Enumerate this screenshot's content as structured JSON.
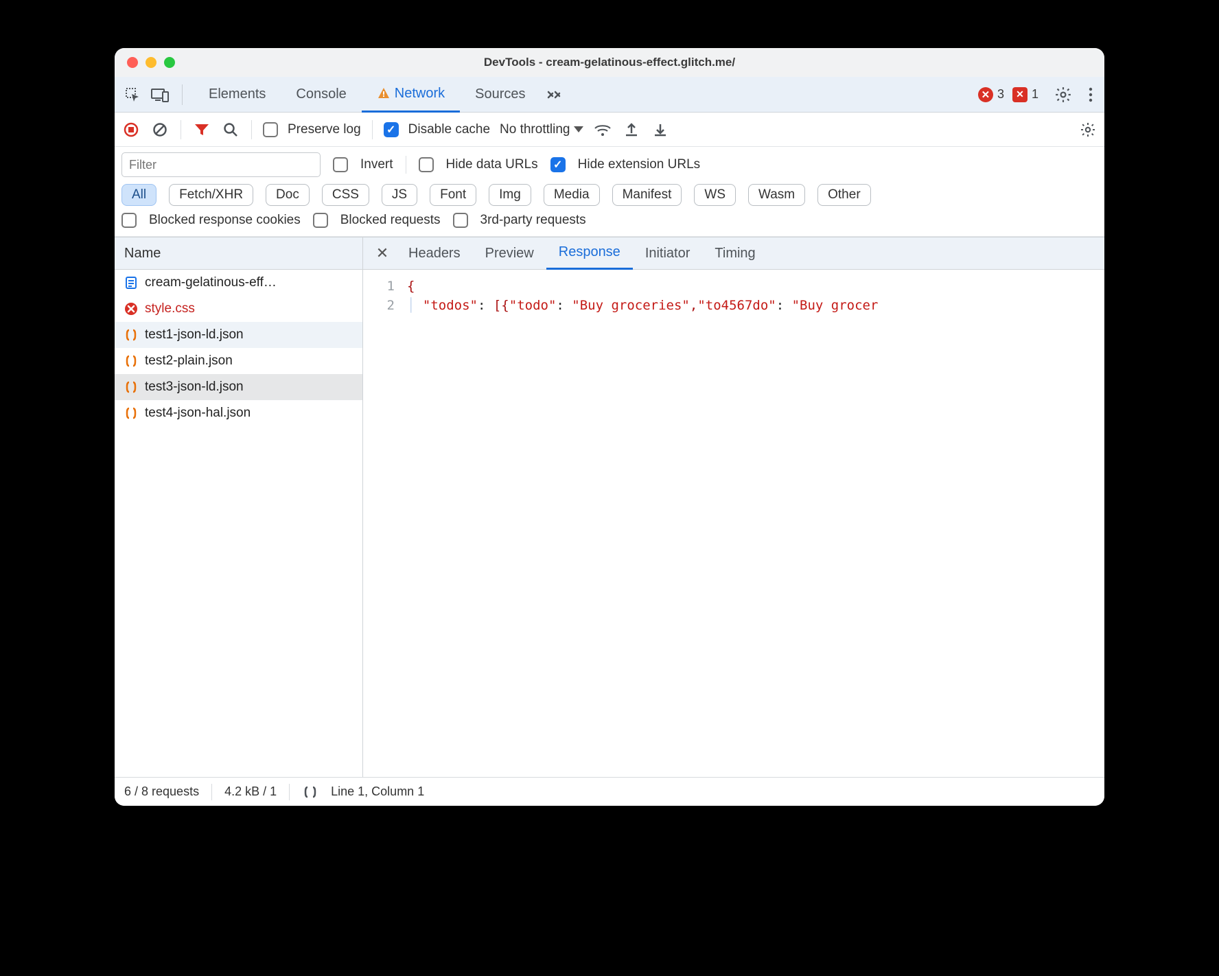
{
  "window": {
    "title": "DevTools - cream-gelatinous-effect.glitch.me/"
  },
  "tabs": {
    "elements": "Elements",
    "console": "Console",
    "network": "Network",
    "sources": "Sources"
  },
  "counters": {
    "errors": "3",
    "issues": "1"
  },
  "toolbar": {
    "preserve_log": "Preserve log",
    "disable_cache": "Disable cache",
    "throttling": "No throttling"
  },
  "filter": {
    "placeholder": "Filter",
    "invert": "Invert",
    "hide_data_urls": "Hide data URLs",
    "hide_ext_urls": "Hide extension URLs",
    "chips": {
      "all": "All",
      "fetch": "Fetch/XHR",
      "doc": "Doc",
      "css": "CSS",
      "js": "JS",
      "font": "Font",
      "img": "Img",
      "media": "Media",
      "manifest": "Manifest",
      "ws": "WS",
      "wasm": "Wasm",
      "other": "Other"
    },
    "blocked_cookies": "Blocked response cookies",
    "blocked_requests": "Blocked requests",
    "third_party": "3rd-party requests"
  },
  "name_header": "Name",
  "requests": [
    {
      "name": "cream-gelatinous-eff…",
      "icon": "doc"
    },
    {
      "name": "style.css",
      "icon": "error"
    },
    {
      "name": "test1-json-ld.json",
      "icon": "json"
    },
    {
      "name": "test2-plain.json",
      "icon": "json"
    },
    {
      "name": "test3-json-ld.json",
      "icon": "json"
    },
    {
      "name": "test4-json-hal.json",
      "icon": "json"
    }
  ],
  "detail_tabs": {
    "headers": "Headers",
    "preview": "Preview",
    "response": "Response",
    "initiator": "Initiator",
    "timing": "Timing"
  },
  "code": {
    "line_numbers": [
      "1",
      "2"
    ],
    "line1": "{",
    "line2_parts": {
      "k_todos": "\"todos\"",
      "colon1": ": ",
      "bracket_open": "[{",
      "k_todo": "\"todo\"",
      "colon2": ": ",
      "v_todo": "\"Buy groceries\"",
      "comma": ",",
      "k_to4567do": "\"to4567do\"",
      "colon3": ": ",
      "v_tail": "\"Buy grocer"
    }
  },
  "status": {
    "requests": "6 / 8 requests",
    "transfer": "4.2 kB / 1",
    "cursor": "Line 1, Column 1"
  }
}
